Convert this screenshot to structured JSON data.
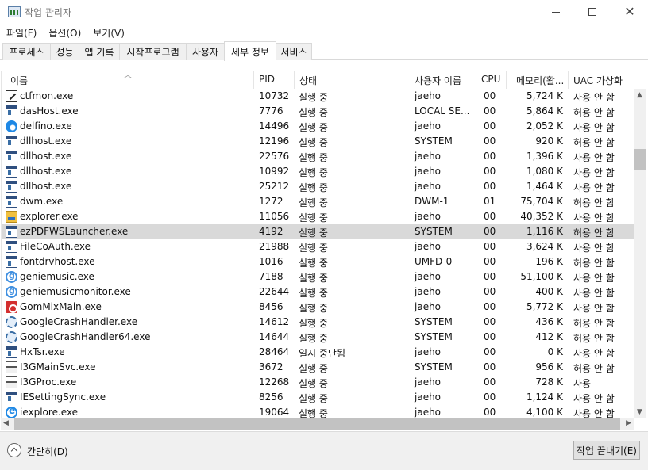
{
  "window": {
    "title": "작업 관리자"
  },
  "menu": [
    {
      "label": "파일(F)"
    },
    {
      "label": "옵션(O)"
    },
    {
      "label": "보기(V)"
    }
  ],
  "tabs": [
    {
      "label": "프로세스"
    },
    {
      "label": "성능"
    },
    {
      "label": "앱 기록"
    },
    {
      "label": "시작프로그램"
    },
    {
      "label": "사용자"
    },
    {
      "label": "세부 정보",
      "active": true
    },
    {
      "label": "서비스"
    }
  ],
  "columns": [
    {
      "label": "이름",
      "sort": "ascending"
    },
    {
      "label": "PID"
    },
    {
      "label": "상태"
    },
    {
      "label": "사용자 이름"
    },
    {
      "label": "CPU"
    },
    {
      "label": "메모리(활..."
    },
    {
      "label": "UAC 가상화"
    }
  ],
  "rows": [
    {
      "icon": "edit-app-icon",
      "name": "ctfmon.exe",
      "pid": "10732",
      "status": "실행 중",
      "user": "jaeho",
      "cpu": "00",
      "memory": "5,724 K",
      "uac": "사용 안 함"
    },
    {
      "icon": "window-app-icon",
      "name": "dasHost.exe",
      "pid": "7776",
      "status": "실행 중",
      "user": "LOCAL SE...",
      "cpu": "00",
      "memory": "5,864 K",
      "uac": "허용 안 함"
    },
    {
      "icon": "delfino-icon",
      "name": "delfino.exe",
      "pid": "14496",
      "status": "실행 중",
      "user": "jaeho",
      "cpu": "00",
      "memory": "2,052 K",
      "uac": "사용 안 함"
    },
    {
      "icon": "window-app-icon",
      "name": "dllhost.exe",
      "pid": "12196",
      "status": "실행 중",
      "user": "SYSTEM",
      "cpu": "00",
      "memory": "920 K",
      "uac": "허용 안 함"
    },
    {
      "icon": "window-app-icon",
      "name": "dllhost.exe",
      "pid": "22576",
      "status": "실행 중",
      "user": "jaeho",
      "cpu": "00",
      "memory": "1,396 K",
      "uac": "사용 안 함"
    },
    {
      "icon": "window-app-icon",
      "name": "dllhost.exe",
      "pid": "10992",
      "status": "실행 중",
      "user": "jaeho",
      "cpu": "00",
      "memory": "1,080 K",
      "uac": "사용 안 함"
    },
    {
      "icon": "window-app-icon",
      "name": "dllhost.exe",
      "pid": "25212",
      "status": "실행 중",
      "user": "jaeho",
      "cpu": "00",
      "memory": "1,464 K",
      "uac": "사용 안 함"
    },
    {
      "icon": "window-app-icon",
      "name": "dwm.exe",
      "pid": "1272",
      "status": "실행 중",
      "user": "DWM-1",
      "cpu": "01",
      "memory": "75,704 K",
      "uac": "허용 안 함"
    },
    {
      "icon": "folder-icon",
      "name": "explorer.exe",
      "pid": "11056",
      "status": "실행 중",
      "user": "jaeho",
      "cpu": "00",
      "memory": "40,352 K",
      "uac": "사용 안 함"
    },
    {
      "icon": "window-app-icon",
      "name": "ezPDFWSLauncher.exe",
      "pid": "4192",
      "status": "실행 중",
      "user": "SYSTEM",
      "cpu": "00",
      "memory": "1,116 K",
      "uac": "허용 안 함",
      "selected": true
    },
    {
      "icon": "window-app-icon",
      "name": "FileCoAuth.exe",
      "pid": "21988",
      "status": "실행 중",
      "user": "jaeho",
      "cpu": "00",
      "memory": "3,624 K",
      "uac": "사용 안 함"
    },
    {
      "icon": "window-app-icon",
      "name": "fontdrvhost.exe",
      "pid": "1016",
      "status": "실행 중",
      "user": "UMFD-0",
      "cpu": "00",
      "memory": "196 K",
      "uac": "허용 안 함"
    },
    {
      "icon": "genie-icon",
      "name": "geniemusic.exe",
      "pid": "7188",
      "status": "실행 중",
      "user": "jaeho",
      "cpu": "00",
      "memory": "51,100 K",
      "uac": "사용 안 함"
    },
    {
      "icon": "genie-icon",
      "name": "geniemusicmonitor.exe",
      "pid": "22644",
      "status": "실행 중",
      "user": "jaeho",
      "cpu": "00",
      "memory": "400 K",
      "uac": "사용 안 함"
    },
    {
      "icon": "gom-icon",
      "name": "GomMixMain.exe",
      "pid": "8456",
      "status": "실행 중",
      "user": "jaeho",
      "cpu": "00",
      "memory": "5,772 K",
      "uac": "사용 안 함"
    },
    {
      "icon": "gear-icon",
      "name": "GoogleCrashHandler.exe",
      "pid": "14612",
      "status": "실행 중",
      "user": "SYSTEM",
      "cpu": "00",
      "memory": "436 K",
      "uac": "허용 안 함"
    },
    {
      "icon": "gear-icon",
      "name": "GoogleCrashHandler64.exe",
      "pid": "14644",
      "status": "실행 중",
      "user": "SYSTEM",
      "cpu": "00",
      "memory": "412 K",
      "uac": "허용 안 함"
    },
    {
      "icon": "window-app-icon",
      "name": "HxTsr.exe",
      "pid": "28464",
      "status": "일시 중단됨",
      "user": "jaeho",
      "cpu": "00",
      "memory": "0 K",
      "uac": "사용 안 함"
    },
    {
      "icon": "i3g-icon",
      "name": "I3GMainSvc.exe",
      "pid": "3672",
      "status": "실행 중",
      "user": "SYSTEM",
      "cpu": "00",
      "memory": "956 K",
      "uac": "허용 안 함"
    },
    {
      "icon": "i3g-icon",
      "name": "I3GProc.exe",
      "pid": "12268",
      "status": "실행 중",
      "user": "jaeho",
      "cpu": "00",
      "memory": "728 K",
      "uac": "사용"
    },
    {
      "icon": "window-app-icon",
      "name": "IESettingSync.exe",
      "pid": "8256",
      "status": "실행 중",
      "user": "jaeho",
      "cpu": "00",
      "memory": "1,124 K",
      "uac": "사용 안 함"
    },
    {
      "icon": "ie-icon",
      "name": "iexplore.exe",
      "pid": "19064",
      "status": "실행 중",
      "user": "jaeho",
      "cpu": "00",
      "memory": "4,100 K",
      "uac": "사용 안 함"
    }
  ],
  "footer": {
    "collapse_label": "간단히(D)",
    "end_task_label": "작업 끝내기(E)"
  }
}
